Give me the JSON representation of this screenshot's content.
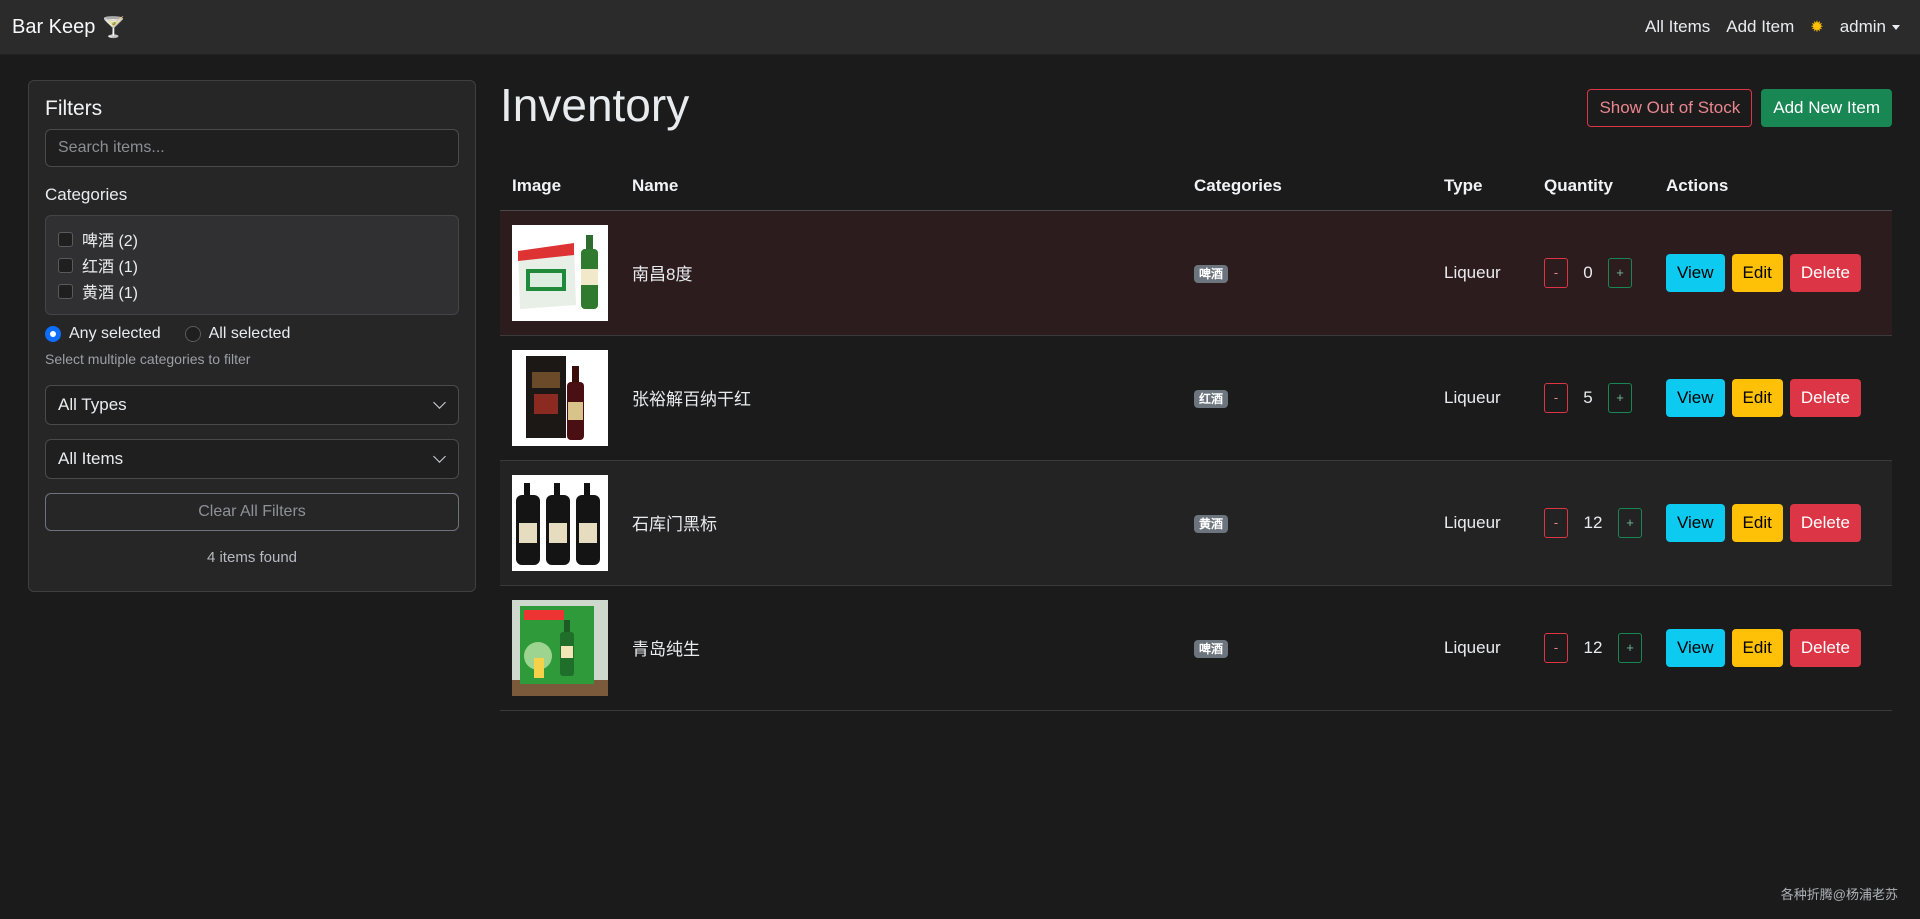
{
  "nav": {
    "brand": "Bar Keep",
    "brand_icon": "🍸",
    "all_items": "All Items",
    "add_item": "Add Item",
    "theme_icon": "✹",
    "user": "admin"
  },
  "filters": {
    "title": "Filters",
    "search_placeholder": "Search items...",
    "categories_label": "Categories",
    "categories": [
      {
        "label": "啤酒 (2)"
      },
      {
        "label": "红酒 (1)"
      },
      {
        "label": "黄酒 (1)"
      }
    ],
    "any_selected": "Any selected",
    "all_selected": "All selected",
    "hint": "Select multiple categories to filter",
    "type_select": "All Types",
    "stock_select": "All Items",
    "clear": "Clear All Filters",
    "found": "4 items found"
  },
  "main": {
    "title": "Inventory",
    "show_out_of_stock": "Show Out of Stock",
    "add_new_item": "Add New Item",
    "columns": [
      "Image",
      "Name",
      "Categories",
      "Type",
      "Quantity",
      "Actions"
    ],
    "rows": [
      {
        "name": "南昌8度",
        "category": "啤酒",
        "type": "Liqueur",
        "minus": "-",
        "quantity": "0",
        "plus": "+",
        "view": "View",
        "edit": "Edit",
        "delete": "Delete"
      },
      {
        "name": "张裕解百纳干红",
        "category": "红酒",
        "type": "Liqueur",
        "minus": "-",
        "quantity": "5",
        "plus": "+",
        "view": "View",
        "edit": "Edit",
        "delete": "Delete"
      },
      {
        "name": "石库门黑标",
        "category": "黄酒",
        "type": "Liqueur",
        "minus": "-",
        "quantity": "12",
        "plus": "+",
        "view": "View",
        "edit": "Edit",
        "delete": "Delete"
      },
      {
        "name": "青岛纯生",
        "category": "啤酒",
        "type": "Liqueur",
        "minus": "-",
        "quantity": "12",
        "plus": "+",
        "view": "View",
        "edit": "Edit",
        "delete": "Delete"
      }
    ]
  },
  "footer": "各种折腾@杨浦老苏"
}
